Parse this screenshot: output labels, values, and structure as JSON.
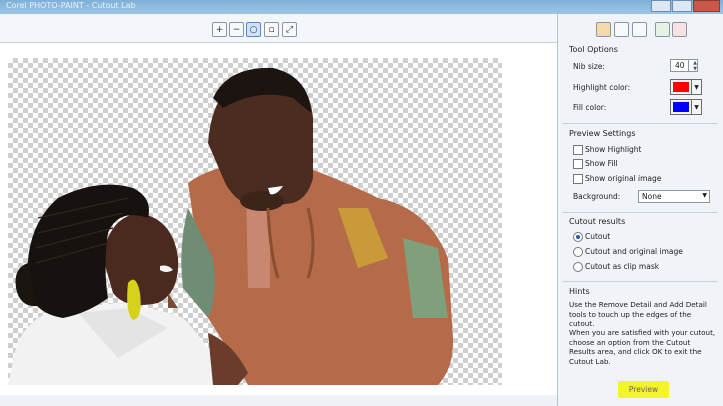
{
  "window": {
    "title": "Corel PHOTO-PAINT - Cutout Lab"
  },
  "toolbar": {
    "icons": [
      "zoom-in-icon",
      "zoom-out-icon",
      "zoom-actual-icon",
      "zoom-fit-icon",
      "zoom-all-icon"
    ],
    "active_index": 2
  },
  "panel": {
    "tool_icons": [
      "highlighter-icon",
      "fill-icon",
      "eraser-icon",
      "add-detail-icon",
      "remove-detail-icon"
    ],
    "tool_options": {
      "title": "Tool Options",
      "nib_label": "Nib size:",
      "nib_value": "40",
      "highlight_label": "Highlight color:",
      "highlight_color": "#ff0000",
      "fill_label": "Fill color:",
      "fill_color": "#0000ff"
    },
    "preview_settings": {
      "title": "Preview Settings",
      "show_highlight": "Show Highlight",
      "show_fill": "Show Fill",
      "show_original": "Show original image",
      "background_label": "Background:",
      "background_value": "None"
    },
    "cutout_results": {
      "title": "Cutout results",
      "options": [
        "Cutout",
        "Cutout and original image",
        "Cutout as clip mask"
      ],
      "selected": 0
    },
    "hints": {
      "title": "Hints",
      "para1": "Use the Remove Detail and Add Detail tools to touch up the edges of the cutout.",
      "para2": "When you are satisfied with your cutout, choose an option from the Cutout Results area, and click OK to exit the Cutout Lab."
    },
    "preview_label": "Preview"
  }
}
